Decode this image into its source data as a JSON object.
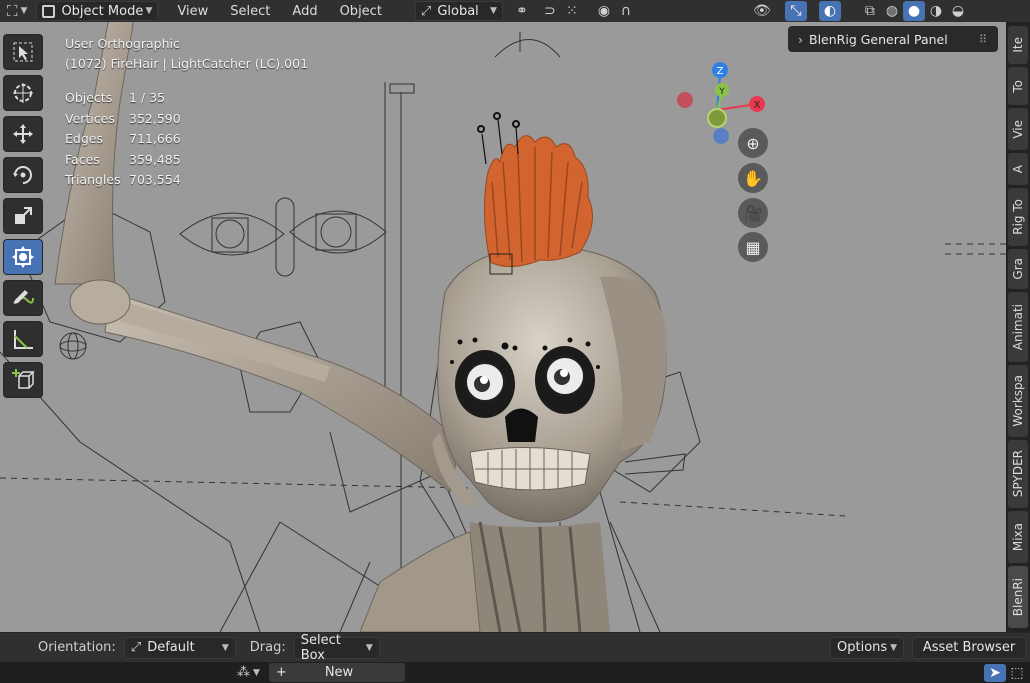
{
  "header": {
    "mode_label": "Object Mode",
    "menus": [
      "View",
      "Select",
      "Add",
      "Object"
    ],
    "transform_orientation": "Global"
  },
  "viewport": {
    "view_name": "User Orthographic",
    "active_object": "(1072) FireHair | LightCatcher (LC).001",
    "stats": [
      {
        "key": "Objects",
        "value": "1 / 35"
      },
      {
        "key": "Vertices",
        "value": "352,590"
      },
      {
        "key": "Edges",
        "value": "711,666"
      },
      {
        "key": "Faces",
        "value": "359,485"
      },
      {
        "key": "Triangles",
        "value": "703,554"
      }
    ],
    "gizmo": {
      "x": "X",
      "y": "Y",
      "z": "Z"
    }
  },
  "panel": {
    "title": "BlenRig General Panel"
  },
  "sidebar_tabs": [
    "Ite",
    "To",
    "Vie",
    "A",
    "Rig To",
    "Gra",
    "Animati",
    "Workspa",
    "SPYDER",
    "Mixa",
    "BlenRi"
  ],
  "tool_settings": {
    "orientation_label": "Orientation:",
    "orientation_value": "Default",
    "drag_label": "Drag:",
    "drag_value": "Select Box",
    "options_label": "Options",
    "asset_browser_label": "Asset Browser"
  },
  "timeline": {
    "new_label": "New"
  },
  "colors": {
    "accent": "#4772b3",
    "viewport_bg": "#9a9a9a",
    "hair": "#d2652f",
    "axis_x": "#e8394f",
    "axis_y": "#8bc34a",
    "axis_z": "#2f7fe6"
  }
}
